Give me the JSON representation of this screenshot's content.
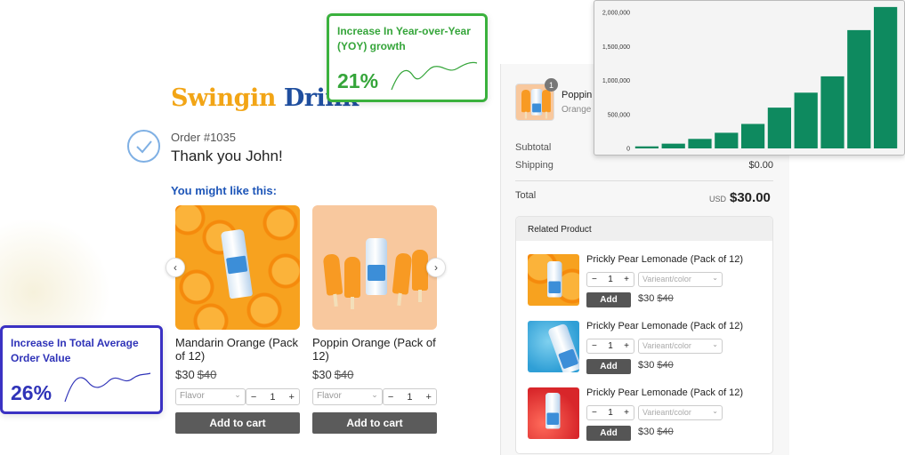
{
  "logo": {
    "part1": "Swingin",
    "part2": "Drink"
  },
  "order": {
    "number": "Order #1035",
    "thanks": "Thank you John!"
  },
  "recommendations": {
    "heading": "You might like this:",
    "items": [
      {
        "name": "Mandarin Orange (Pack of 12)",
        "price": "$30",
        "old_price": "$40",
        "flavor_placeholder": "Flavor",
        "qty": "1",
        "button": "Add to cart"
      },
      {
        "name": "Poppin Orange (Pack of 12)",
        "price": "$30",
        "old_price": "$40",
        "flavor_placeholder": "Flavor",
        "qty": "1",
        "button": "Add to cart"
      }
    ]
  },
  "cart": {
    "item_badge": "1",
    "item_name": "Poppin",
    "item_variant": "Orange",
    "subtotal_label": "Subtotal",
    "shipping_label": "Shipping",
    "shipping_value": "$0.00",
    "total_label": "Total",
    "currency": "USD",
    "total_value": "$30.00"
  },
  "related": {
    "heading": "Related Product",
    "items": [
      {
        "name": "Prickly Pear Lemonade (Pack of 12)",
        "qty": "1",
        "variant_placeholder": "Varieant/color",
        "button": "Add",
        "price": "$30",
        "old_price": "$40"
      },
      {
        "name": "Prickly Pear Lemonade (Pack of 12)",
        "qty": "1",
        "variant_placeholder": "Varieant/color",
        "button": "Add",
        "price": "$30",
        "old_price": "$40"
      },
      {
        "name": "Prickly Pear Lemonade (Pack of 12)",
        "qty": "1",
        "variant_placeholder": "Varieant/color",
        "button": "Add",
        "price": "$30",
        "old_price": "$40"
      }
    ]
  },
  "stats": {
    "yoy": {
      "title": "Increase In Year-over-Year (YOY) growth",
      "value": "21%",
      "color": "#35a53a"
    },
    "aov": {
      "title": "Increase In Total Average Order Value",
      "value": "26%",
      "color": "#2f33b8"
    }
  },
  "chart_data": {
    "type": "bar",
    "color": "#0e8a5f",
    "ylim": [
      0,
      2000000
    ],
    "yticks": [
      0,
      500000,
      1000000,
      1500000,
      2000000
    ],
    "ytick_labels": [
      "0",
      "500,000",
      "1,000,000",
      "1,500,000",
      "2,000,000"
    ],
    "values": [
      30000,
      70000,
      140000,
      230000,
      360000,
      600000,
      820000,
      1060000,
      1740000,
      2080000
    ]
  },
  "icons": {
    "check": "check-circle-icon",
    "prev": "chevron-left-icon",
    "next": "chevron-right-icon",
    "select": "chevron-down-icon"
  }
}
